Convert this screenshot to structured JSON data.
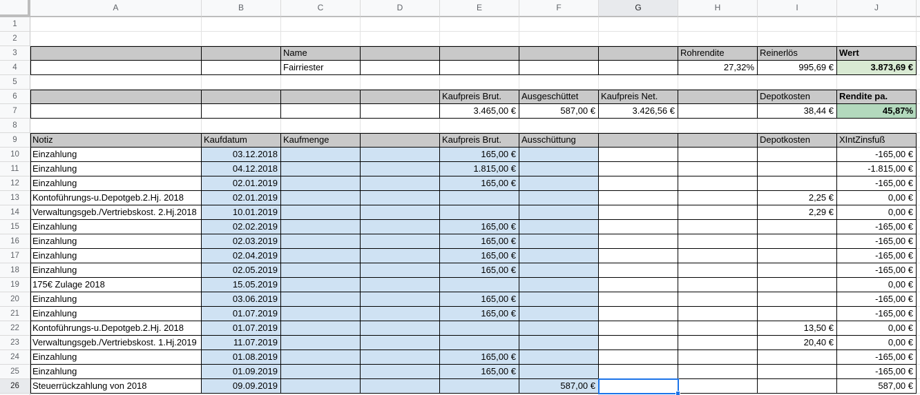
{
  "sheet": {
    "column_letters": [
      "A",
      "B",
      "C",
      "D",
      "E",
      "F",
      "G",
      "H",
      "I",
      "J"
    ],
    "row_numbers": [
      "1",
      "2",
      "3",
      "4",
      "5",
      "6",
      "7",
      "8",
      "9",
      "10",
      "11",
      "12",
      "13",
      "14",
      "15",
      "16",
      "17",
      "18",
      "19",
      "20",
      "21",
      "22",
      "23",
      "24",
      "25",
      "26"
    ],
    "selection": {
      "cell": "G26",
      "column": "G",
      "row": "26"
    }
  },
  "colors": {
    "band_gray": "#c9c9c9",
    "cell_blue": "#cfe2f3",
    "green_pale": "#d9ead3",
    "green_soft": "#b3d9bd",
    "selection_blue": "#1a73e8",
    "grid_line": "#e2e2e2",
    "range_border": "#000000",
    "header_bg": "#f8f9fa",
    "header_selected_bg": "#e8eaed",
    "header_text": "#5f6368"
  },
  "summary_value_block": {
    "labels": {
      "C3": "Name",
      "H3": "Rohrendite",
      "I3": "Reinerlös",
      "J3": "Wert"
    },
    "values": {
      "C4": "Fairriester",
      "H4": "27,32%",
      "I4": "995,69 €",
      "J4": "3.873,69 €"
    }
  },
  "summary_cost_block": {
    "labels": {
      "E6": "Kaufpreis Brut.",
      "F6": "Ausgeschüttet",
      "G6": "Kaufpreis Net.",
      "I6": "Depotkosten",
      "J6": "Rendite pa."
    },
    "values": {
      "E7": "3.465,00 €",
      "F7": "587,00 €",
      "G7": "3.426,56 €",
      "I7": "38,44 €",
      "J7": "45,87%"
    }
  },
  "ledger": {
    "headers": {
      "A": "Notiz",
      "B": "Kaufdatum",
      "C": "Kaufmenge",
      "E": "Kaufpreis Brut.",
      "F": "Ausschüttung",
      "I": "Depotkosten",
      "J": "XIntZinsfuß"
    },
    "rows": [
      {
        "row": "10",
        "A": "Einzahlung",
        "B": "03.12.2018",
        "E": "165,00 €",
        "J": "-165,00 €"
      },
      {
        "row": "11",
        "A": "Einzahlung",
        "B": "04.12.2018",
        "E": "1.815,00 €",
        "J": "-1.815,00 €"
      },
      {
        "row": "12",
        "A": "Einzahlung",
        "B": "02.01.2019",
        "E": "165,00 €",
        "J": "-165,00 €"
      },
      {
        "row": "13",
        "A": "Kontoführungs-u.Depotgeb.2.Hj. 2018",
        "B": "02.01.2019",
        "I": "2,25 €",
        "J": "0,00 €"
      },
      {
        "row": "14",
        "A": "Verwaltungsgeb./Vertriebskost. 2.Hj.2018",
        "B": "10.01.2019",
        "I": "2,29 €",
        "J": "0,00 €"
      },
      {
        "row": "15",
        "A": "Einzahlung",
        "B": "02.02.2019",
        "E": "165,00 €",
        "J": "-165,00 €"
      },
      {
        "row": "16",
        "A": "Einzahlung",
        "B": "02.03.2019",
        "E": "165,00 €",
        "J": "-165,00 €"
      },
      {
        "row": "17",
        "A": "Einzahlung",
        "B": "02.04.2019",
        "E": "165,00 €",
        "J": "-165,00 €"
      },
      {
        "row": "18",
        "A": "Einzahlung",
        "B": "02.05.2019",
        "E": "165,00 €",
        "J": "-165,00 €"
      },
      {
        "row": "19",
        "A": "175€ Zulage 2018",
        "B": "15.05.2019",
        "J": "0,00 €"
      },
      {
        "row": "20",
        "A": "Einzahlung",
        "B": "03.06.2019",
        "E": "165,00 €",
        "J": "-165,00 €"
      },
      {
        "row": "21",
        "A": "Einzahlung",
        "B": "01.07.2019",
        "E": "165,00 €",
        "J": "-165,00 €"
      },
      {
        "row": "22",
        "A": "Kontoführungs-u.Depotgeb.2.Hj. 2018",
        "B": "01.07.2019",
        "I": "13,50 €",
        "J": "0,00 €"
      },
      {
        "row": "23",
        "A": "Verwaltungsgeb./Vertriebskost. 1.Hj.2019",
        "B": "11.07.2019",
        "I": "20,40 €",
        "J": "0,00 €"
      },
      {
        "row": "24",
        "A": "Einzahlung",
        "B": "01.08.2019",
        "E": "165,00 €",
        "J": "-165,00 €"
      },
      {
        "row": "25",
        "A": "Einzahlung",
        "B": "01.09.2019",
        "E": "165,00 €",
        "J": "-165,00 €"
      },
      {
        "row": "26",
        "A": "Steuerrückzahlung von 2018",
        "B": "09.09.2019",
        "F": "587,00 €",
        "J": "587,00 €"
      }
    ]
  },
  "formatting": {
    "gray_band_rows": [
      "3",
      "6",
      "9"
    ],
    "blue_range": "B10:F26",
    "green_cells": {
      "J4": "green_pale",
      "J7": "green_soft"
    },
    "bold_cells": [
      "J3",
      "J4",
      "J6",
      "J7"
    ],
    "black_border_ranges": [
      "A3:J4",
      "A6:J7",
      "A9:J26"
    ]
  }
}
